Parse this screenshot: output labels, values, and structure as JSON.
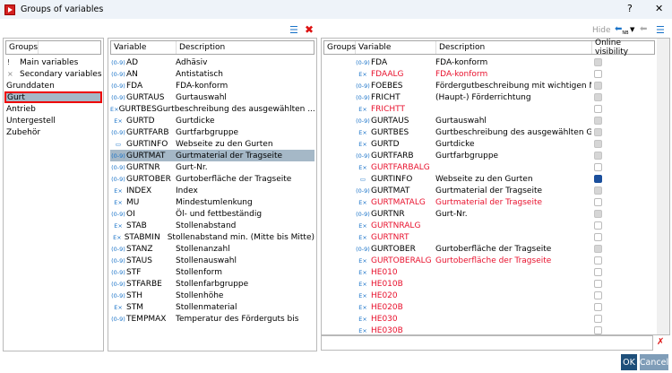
{
  "window": {
    "title": "Groups of variables",
    "help": "?",
    "close": "✕"
  },
  "toolbar": {
    "hide_label": "Hide"
  },
  "groups": {
    "header": "Groups",
    "items": [
      {
        "label": "Main variables",
        "icon": "pin-icon"
      },
      {
        "label": "Secondary variables",
        "icon": "x-icon"
      },
      {
        "label": "Grunddaten"
      },
      {
        "label": "Gurt",
        "selected": true
      },
      {
        "label": "Antrieb"
      },
      {
        "label": "Untergestell"
      },
      {
        "label": "Zubehör"
      }
    ]
  },
  "variables": {
    "headers": [
      "Variable",
      "Description"
    ],
    "rows": [
      [
        "num",
        "AD",
        "Adhäsiv"
      ],
      [
        "num",
        "AN",
        "Antistatisch"
      ],
      [
        "num",
        "FDA",
        "FDA-konform"
      ],
      [
        "num",
        "GURTAUS",
        "Gurtauswahl"
      ],
      [
        "txt",
        "GURTBES",
        "Gurtbeschreibung des ausgewählten ..."
      ],
      [
        "txt",
        "GURTD",
        "Gurtdicke"
      ],
      [
        "num",
        "GURTFARB",
        "Gurtfarbgruppe"
      ],
      [
        "box",
        "GURTINFO",
        "Webseite zu den Gurten"
      ],
      [
        "num",
        "GURTMAT",
        "Gurtmaterial der Tragseite"
      ],
      [
        "num",
        "GURTNR",
        "Gurt-Nr."
      ],
      [
        "num",
        "GURTOBER",
        "Gurtoberfläche der Tragseite"
      ],
      [
        "txt",
        "INDEX",
        "Index"
      ],
      [
        "txt",
        "MU",
        "Mindestumlenkung"
      ],
      [
        "num",
        "OI",
        "Öl- und fettbeständig"
      ],
      [
        "txt",
        "STAB",
        "Stollenabstand"
      ],
      [
        "txt",
        "STABMIN",
        "Stollenabstand min. (Mitte bis Mitte)"
      ],
      [
        "num",
        "STANZ",
        "Stollenanzahl"
      ],
      [
        "num",
        "STAUS",
        "Stollenauswahl"
      ],
      [
        "num",
        "STF",
        "Stollenform"
      ],
      [
        "num",
        "STFARBE",
        "Stollenfarbgruppe"
      ],
      [
        "num",
        "STH",
        "Stollenhöhe"
      ],
      [
        "txt",
        "STM",
        "Stollenmaterial"
      ],
      [
        "num",
        "TEMPMAX",
        "Temperatur des Förderguts bis"
      ]
    ],
    "selected": "GURTMAT"
  },
  "online": {
    "headers": [
      "Groups",
      "Variable",
      "Description",
      "Online visibility"
    ],
    "rows": [
      [
        "num",
        "FDA",
        "FDA-konform",
        "dis",
        false
      ],
      [
        "txt",
        "FDAALG",
        "FDA-konform",
        "off",
        true
      ],
      [
        "num",
        "FOEBES",
        "Fördergutbeschreibung mit wichtigen Mer...",
        "dis",
        false
      ],
      [
        "num",
        "FRICHT",
        "(Haupt-) Förderrichtung",
        "dis",
        false
      ],
      [
        "txt",
        "FRICHTT",
        "",
        "off",
        true
      ],
      [
        "num",
        "GURTAUS",
        "Gurtauswahl",
        "dis",
        false
      ],
      [
        "txt",
        "GURTBES",
        "Gurtbeschreibung des ausgewählten Gurtes",
        "dis",
        false
      ],
      [
        "txt",
        "GURTD",
        "Gurtdicke",
        "dis",
        false
      ],
      [
        "num",
        "GURTFARB",
        "Gurtfarbgruppe",
        "dis",
        false
      ],
      [
        "txt",
        "GURTFARBALG",
        "",
        "off",
        true
      ],
      [
        "box",
        "GURTINFO",
        "Webseite zu den Gurten",
        "on",
        false
      ],
      [
        "num",
        "GURTMAT",
        "Gurtmaterial der Tragseite",
        "dis",
        false
      ],
      [
        "txt",
        "GURTMATALG",
        "Gurtmaterial der Tragseite",
        "off",
        true
      ],
      [
        "num",
        "GURTNR",
        "Gurt-Nr.",
        "dis",
        false
      ],
      [
        "txt",
        "GURTNRALG",
        "",
        "off",
        true
      ],
      [
        "txt",
        "GURTNRT",
        "",
        "off",
        true
      ],
      [
        "num",
        "GURTOBER",
        "Gurtoberfläche der Tragseite",
        "dis",
        false
      ],
      [
        "txt",
        "GURTOBERALG",
        "Gurtoberfläche der Tragseite",
        "off",
        true
      ],
      [
        "txt",
        "HE010",
        "",
        "off",
        true
      ],
      [
        "txt",
        "HE010B",
        "",
        "off",
        true
      ],
      [
        "txt",
        "HE020",
        "",
        "off",
        true
      ],
      [
        "txt",
        "HE020B",
        "",
        "off",
        true
      ],
      [
        "txt",
        "HE030",
        "",
        "off",
        true
      ],
      [
        "txt",
        "HE030B",
        "",
        "off",
        true
      ]
    ]
  },
  "filter": {
    "value": ""
  },
  "buttons": {
    "ok": "OK",
    "cancel": "Cancel"
  },
  "colors": {
    "error_red": "#e8112d",
    "ok_button": "#1e4f7a",
    "cancel_button": "#7f9db8",
    "selection": "#a5b8c7"
  }
}
